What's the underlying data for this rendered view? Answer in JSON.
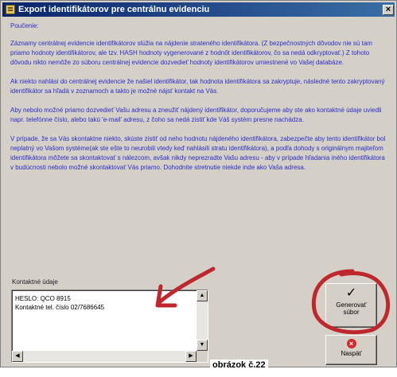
{
  "window": {
    "title": "Export identifikátorov pre centrálnu evidenciu",
    "close_label": "×"
  },
  "info": {
    "heading": "Poučenie:",
    "paragraphs": [
      "Záznamy centrálnej evidencie identifikátorov slúžia na nájdenie strateného identifikátora. (Z bezpečnostných dôvodov nie sú tam priamo hodnoty identifikátorov, ale tzv. HASH hodnoty vygenerované z hodnôt identifikátorov, čo sa nedá odkryptovať.) Z tohoto dôvodu nikto nemôže zo súboru centrálnej evidencie dozvedieť hodnoty identifikátorov umiestnené vo Vašej databáze.",
      "Ak niekto nahlási do centrálnej evidencie že našiel identifikátor, tak hodnota identifikátora sa zakryptuje, následné tento zakryptovaný identifikátor sa hľadá v zoznamoch a takto je možné nájsť kontakt na Vás.",
      "Aby nebolo možné priamo dozvedieť Vašu adresu a zneužiť nájdený identifikátor, doporučujeme aby ste ako kontaktné údaje uviedli napr. telefónne číslo, alebo takú 'e-mail' adresu, z čoho sa nedá zistiť kde Váš systém presne nachádza.",
      "V prípade, že sa Vás skontaktne niekto, skúste zistiť od neho hodnotu nájdeného identifikátora, zabezpečte aby tento identifikátor bol neplatný vo Vašom systéme(ak ste ešte to neurobili vtedy keď nahlásili stratu identifikátora), a podľa dohody s originálnym majiteľom identifikátora môžete sa skontaktovať s nálezcom, avšak nikdy neprezradte Vašu adresu - aby v prípade hľadania iného identifikátora v budúcnosti nebolo možné skontaktovať Vás priamo. Dohodnite stretnutie niekde inde ako Vaša adresa."
    ]
  },
  "contact": {
    "label": "Kontaktné údaje",
    "value": "HESLO: QCO 8915\nKontaktné tel. číslo 02/7686645"
  },
  "buttons": {
    "generate_label_1": "Generovať",
    "generate_label_2": "súbor",
    "generate_icon": "checkmark-icon",
    "cancel_label": "Naspäť",
    "cancel_icon": "cancel-x-icon"
  },
  "scroll_glyphs": {
    "up": "▲",
    "down": "▼",
    "left": "◀",
    "right": "▶"
  },
  "caption": "obrázok č.22",
  "annotation_color": "#c0272d"
}
